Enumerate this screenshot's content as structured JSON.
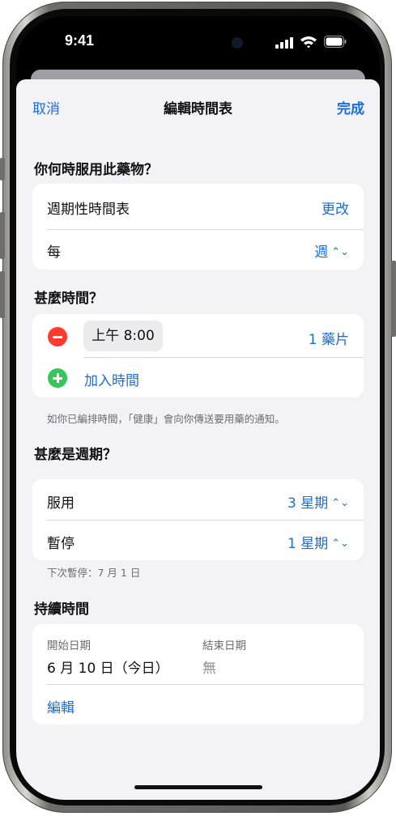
{
  "status_bar": {
    "time": "9:41"
  },
  "nav": {
    "cancel": "取消",
    "title": "編輯時間表",
    "done": "完成"
  },
  "when": {
    "heading": "你何時服用此藥物？",
    "schedule_label": "週期性時間表",
    "schedule_action": "更改",
    "frequency_label": "每",
    "frequency_value": "週"
  },
  "times": {
    "heading": "甚麼時間？",
    "entries": [
      {
        "time": "上午 8:00",
        "dose": "1 藥片"
      }
    ],
    "add_label": "加入時間",
    "footer": "如你已編排時間，「健康」會向你傳送要用藥的通知。"
  },
  "cycle": {
    "heading": "甚麼是週期？",
    "take_label": "服用",
    "take_value": "3 星期",
    "pause_label": "暫停",
    "pause_value": "1 星期",
    "next_pause": "下次暫停：7 月 1 日"
  },
  "duration": {
    "heading": "持續時間",
    "start_label": "開始日期",
    "start_value": "6 月 10 日（今日）",
    "end_label": "結束日期",
    "end_value": "無",
    "edit": "編輯"
  },
  "colors": {
    "accent": "#1a6fe0",
    "remove": "#ff3b30",
    "add": "#34c759",
    "background": "#f2f2f7"
  },
  "icons": [
    "cellular-signal-icon",
    "wifi-icon",
    "battery-icon",
    "remove-icon",
    "add-icon",
    "chevron-updown-icon"
  ]
}
